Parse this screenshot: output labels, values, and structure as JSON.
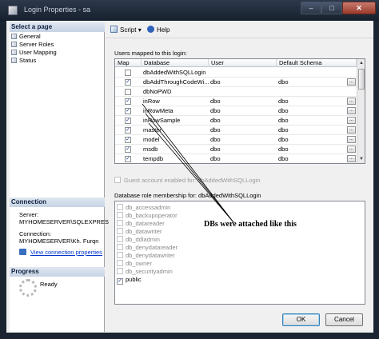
{
  "window": {
    "title": "Login Properties - sa"
  },
  "left": {
    "select_page_header": "Select a page",
    "pages": [
      "General",
      "Server Roles",
      "User Mapping",
      "Status"
    ],
    "connection_header": "Connection",
    "server_label": "Server:",
    "server_value": "MYHOMESERVER\\SQLEXPRES",
    "connection_label": "Connection:",
    "connection_value": "MYHOMESERVER\\Kh. Furqn",
    "view_link": "View connection properties",
    "progress_header": "Progress",
    "progress_status": "Ready"
  },
  "toolbar": {
    "script_label": "Script",
    "help_label": "Help"
  },
  "users_mapped": {
    "label": "Users mapped to this login:",
    "columns": [
      "Map",
      "Database",
      "User",
      "Default Schema"
    ],
    "rows": [
      {
        "map": false,
        "database": "dbAddedWithSQLLogin",
        "user": "",
        "schema": ""
      },
      {
        "map": true,
        "database": "dbAddThroughCodeWi...",
        "user": "dbo",
        "schema": "dbo"
      },
      {
        "map": false,
        "database": "dbNoPWD",
        "user": "",
        "schema": ""
      },
      {
        "map": true,
        "database": "inRow",
        "user": "dbo",
        "schema": "dbo"
      },
      {
        "map": true,
        "database": "inRowMeta",
        "user": "dbo",
        "schema": "dbo"
      },
      {
        "map": true,
        "database": "inRowSample",
        "user": "dbo",
        "schema": "dbo"
      },
      {
        "map": true,
        "database": "master",
        "user": "dbo",
        "schema": "dbo"
      },
      {
        "map": true,
        "database": "model",
        "user": "dbo",
        "schema": "dbo"
      },
      {
        "map": true,
        "database": "msdb",
        "user": "dbo",
        "schema": "dbo"
      },
      {
        "map": true,
        "database": "tempdb",
        "user": "dbo",
        "schema": "dbo"
      }
    ]
  },
  "guest_label": "Guest account enabled for: dbAddedWithSQLLogin",
  "role_membership": {
    "label": "Database role membership for: dbAddedWithSQLLogin",
    "roles": [
      {
        "name": "db_accessadmin",
        "checked": false
      },
      {
        "name": "db_backupoperator",
        "checked": false
      },
      {
        "name": "db_datareader",
        "checked": false
      },
      {
        "name": "db_datawriter",
        "checked": false
      },
      {
        "name": "db_ddladmin",
        "checked": false
      },
      {
        "name": "db_denydatareader",
        "checked": false
      },
      {
        "name": "db_denydatawriter",
        "checked": false
      },
      {
        "name": "db_owner",
        "checked": false
      },
      {
        "name": "db_securityadmin",
        "checked": false
      },
      {
        "name": "public",
        "checked": true
      }
    ]
  },
  "annotation": "DBs were attached like this",
  "buttons": {
    "ok": "OK",
    "cancel": "Cancel"
  }
}
